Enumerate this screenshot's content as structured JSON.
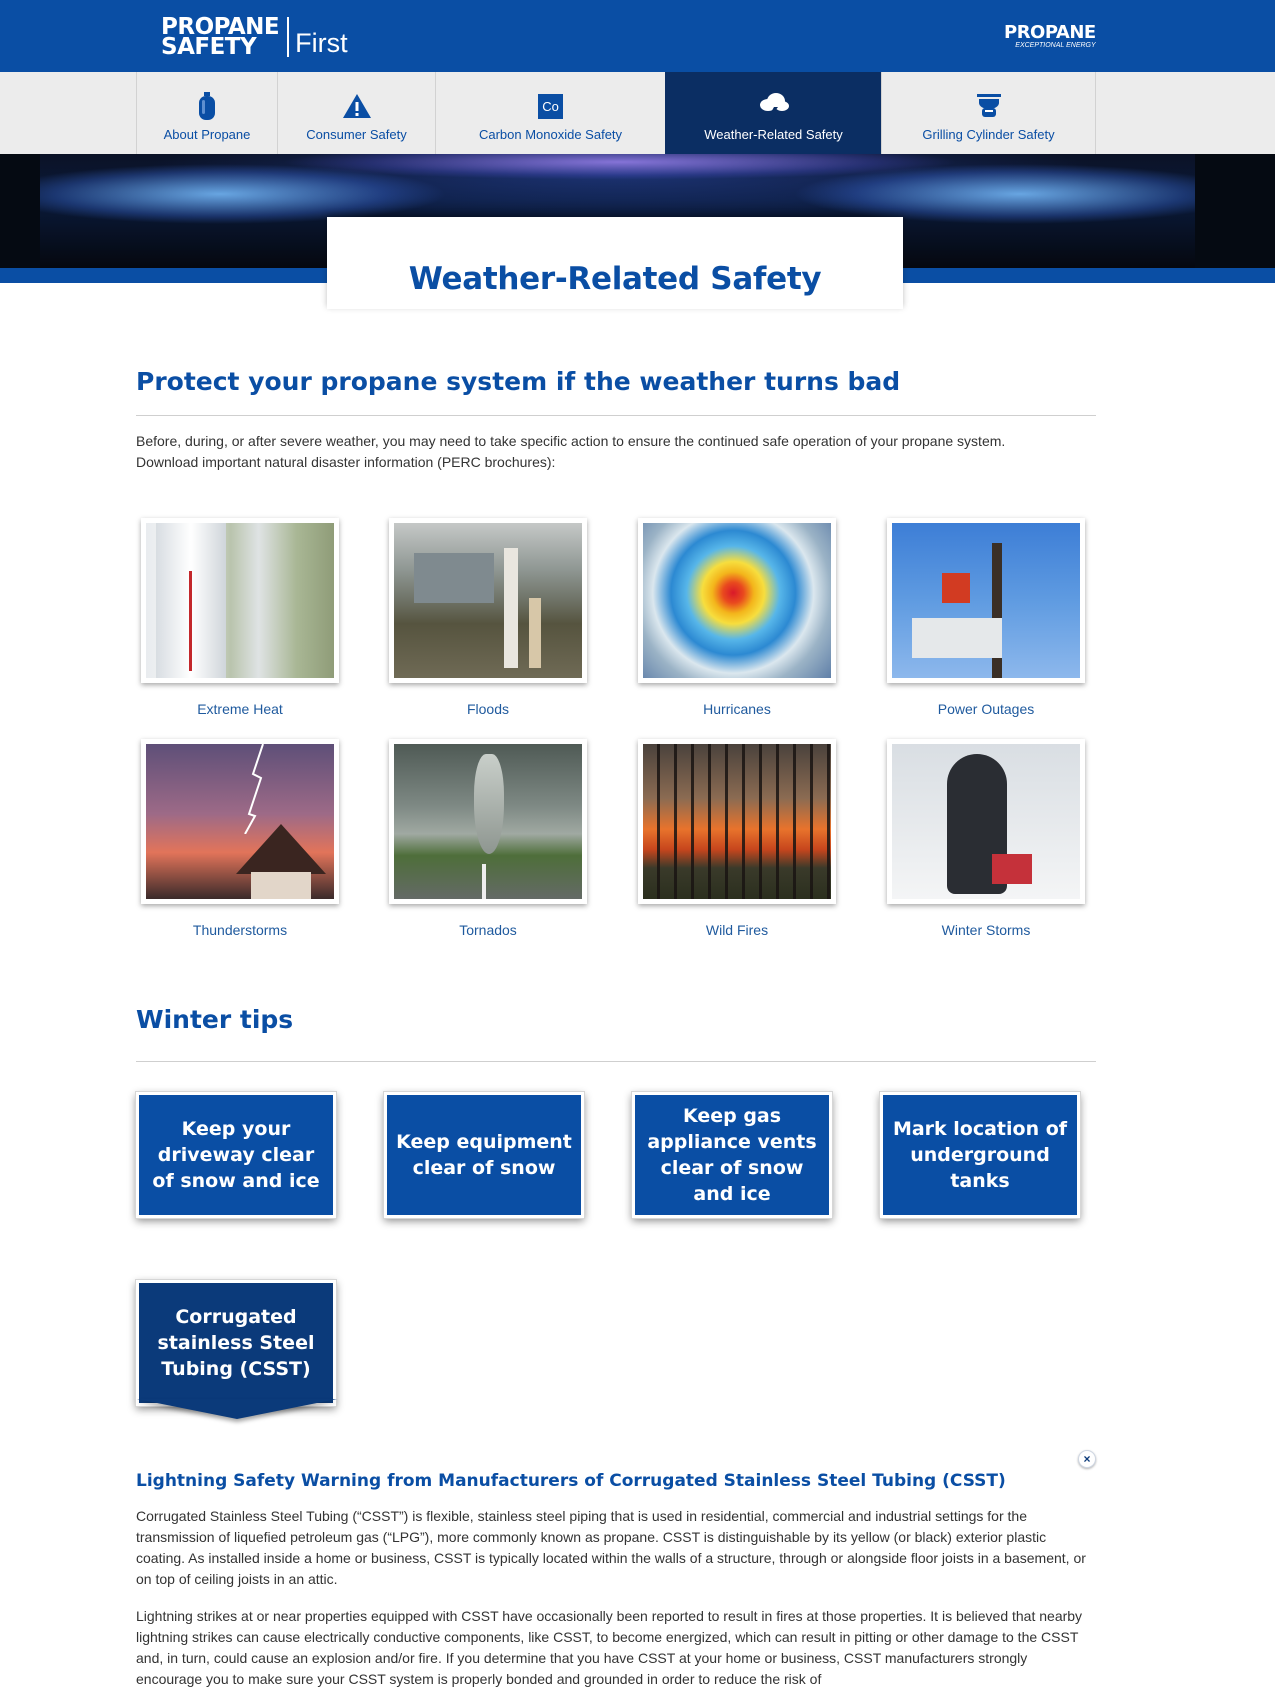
{
  "header": {
    "logo_line1": "PROPANE",
    "logo_line2": "SAFETY",
    "logo_line3": "First",
    "brand_name": "PROPANE",
    "brand_tagline": "EXCEPTIONAL ENERGY"
  },
  "nav": {
    "tabs": [
      {
        "label": "About Propane",
        "icon": "propane-tank-icon"
      },
      {
        "label": "Consumer Safety",
        "icon": "warning-icon"
      },
      {
        "label": "Carbon Monoxide Safety",
        "icon": "co-icon",
        "icon_text": "Co"
      },
      {
        "label": "Weather-Related Safety",
        "icon": "storm-cloud-icon",
        "active": true
      },
      {
        "label": "Grilling Cylinder Safety",
        "icon": "grill-icon"
      }
    ]
  },
  "page": {
    "title": "Weather-Related Safety"
  },
  "weather": {
    "heading": "Protect your propane system if the weather turns bad",
    "intro_line1": "Before, during, or after severe weather, you may need to take specific action to ensure the continued safe operation of your propane system.",
    "intro_line2": "Download important natural disaster information (PERC brochures):",
    "items": [
      {
        "caption": "Extreme Heat"
      },
      {
        "caption": "Floods"
      },
      {
        "caption": "Hurricanes"
      },
      {
        "caption": "Power Outages"
      },
      {
        "caption": "Thunderstorms"
      },
      {
        "caption": "Tornados"
      },
      {
        "caption": "Wild Fires"
      },
      {
        "caption": "Winter Storms"
      }
    ]
  },
  "winter": {
    "heading": "Winter tips",
    "tips": [
      {
        "label": "Keep your driveway clear of snow and ice"
      },
      {
        "label": "Keep equipment clear of snow"
      },
      {
        "label": "Keep gas appliance vents clear of snow and ice"
      },
      {
        "label": "Mark location of underground tanks"
      },
      {
        "label": "Corrugated stainless Steel Tubing (CSST)",
        "active": true
      }
    ]
  },
  "csst": {
    "title": "Lightning Safety Warning from Manufacturers of Corrugated Stainless Steel Tubing (CSST)",
    "close_label": "×",
    "para1": "Corrugated Stainless Steel Tubing (“CSST”) is flexible, stainless steel piping that is used in residential, commercial and industrial settings for the transmission of liquefied petroleum gas (“LPG”), more commonly known as propane. CSST is distinguishable by its yellow (or black) exterior plastic coating. As installed inside a home or business, CSST is typically located within the walls of a structure, through or alongside floor joists in a basement, or on top of ceiling joists in an attic.",
    "para2": "Lightning strikes at or near properties equipped with CSST have occasionally been reported to result in fires at those properties. It is believed that nearby lightning strikes can cause electrically conductive components, like CSST, to become energized, which can result in pitting or other damage to the CSST and, in turn, could cause an explosion and/or fire. If you determine that you have CSST at your home or business, CSST manufacturers strongly encourage you to make sure your CSST system is properly bonded and grounded in order to reduce the risk of"
  },
  "colors": {
    "brand_blue": "#0a4ea4",
    "nav_active": "#0b2e63",
    "link_blue": "#1f5a9e"
  }
}
